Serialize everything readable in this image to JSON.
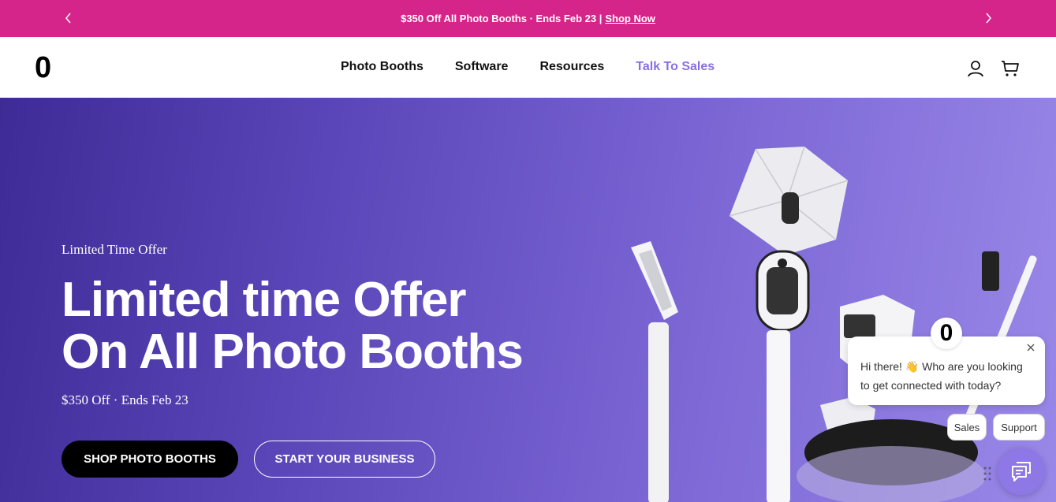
{
  "announcement": {
    "text": "$350 Off All Photo Booths · Ends Feb 23 |",
    "link_label": "Shop Now"
  },
  "header": {
    "logo": "0",
    "nav": [
      {
        "label": "Photo Booths"
      },
      {
        "label": "Software"
      },
      {
        "label": "Resources"
      },
      {
        "label": "Talk To Sales"
      }
    ],
    "icons": [
      "user-icon",
      "cart-icon"
    ]
  },
  "hero": {
    "eyebrow": "Limited Time Offer",
    "headline_line1": "Limited time Offer",
    "headline_line2": "On All Photo Booths",
    "subline": "$350 Off · Ends Feb 23",
    "primary_cta": "SHOP PHOTO BOOTHS",
    "secondary_cta": "START YOUR BUSINESS"
  },
  "chat": {
    "logo": "0",
    "message": "Hi there! 👋 Who are you looking to get connected with today?",
    "options": [
      "Sales",
      "Support"
    ]
  },
  "colors": {
    "announcement_bg": "#d6258a",
    "nav_accent": "#8a6fe0",
    "hero_gradient_start": "#3e2b96",
    "hero_gradient_end": "#9a88e8",
    "chat_launcher": "#8d78e6"
  }
}
